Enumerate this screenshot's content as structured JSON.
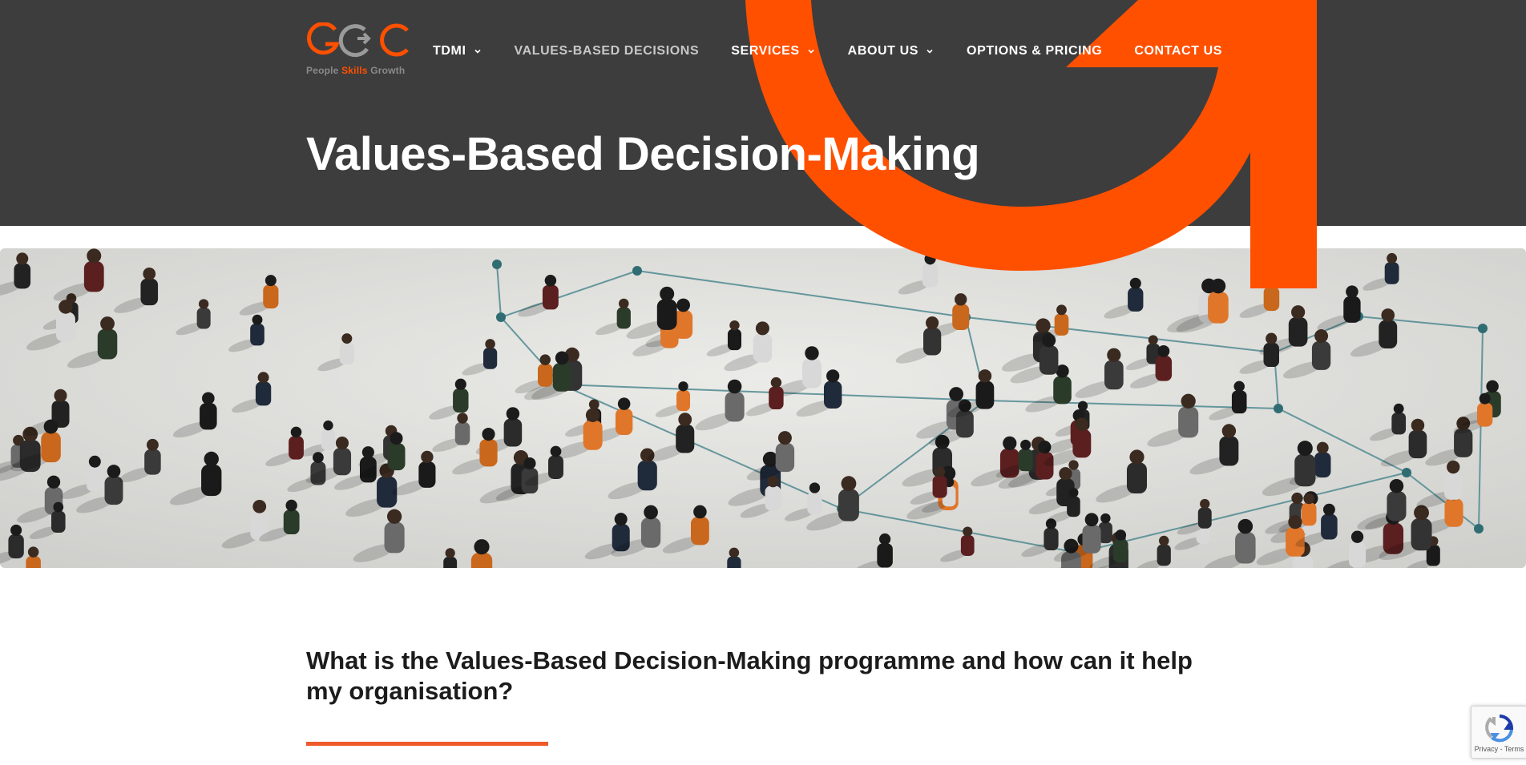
{
  "brand": {
    "logo_alt": "GOC",
    "tagline_part1": "People ",
    "tagline_accent": "Skills",
    "tagline_part2": " Growth",
    "accent_color": "#ff5000"
  },
  "nav": {
    "items": [
      {
        "label": "TDMI",
        "has_dropdown": true,
        "current": false
      },
      {
        "label": "VALUES-BASED DECISIONS",
        "has_dropdown": false,
        "current": true
      },
      {
        "label": "SERVICES",
        "has_dropdown": true,
        "current": false
      },
      {
        "label": "ABOUT US",
        "has_dropdown": true,
        "current": false
      },
      {
        "label": "OPTIONS & PRICING",
        "has_dropdown": false,
        "current": false
      },
      {
        "label": "CONTACT US",
        "has_dropdown": false,
        "current": false
      }
    ]
  },
  "page": {
    "title": "Values-Based Decision-Making",
    "hero_image_subject": "aerial crowd of people connected by network lines",
    "section_heading": "What is the Values-Based Decision-Making programme and how can it help my organisation?"
  },
  "recaptcha": {
    "links": "Privacy - Terms",
    "icon": "recaptcha-icon"
  },
  "colors": {
    "header_bg": "#3d3d3d",
    "accent": "#ff5000",
    "divider": "#ee5a2a"
  }
}
